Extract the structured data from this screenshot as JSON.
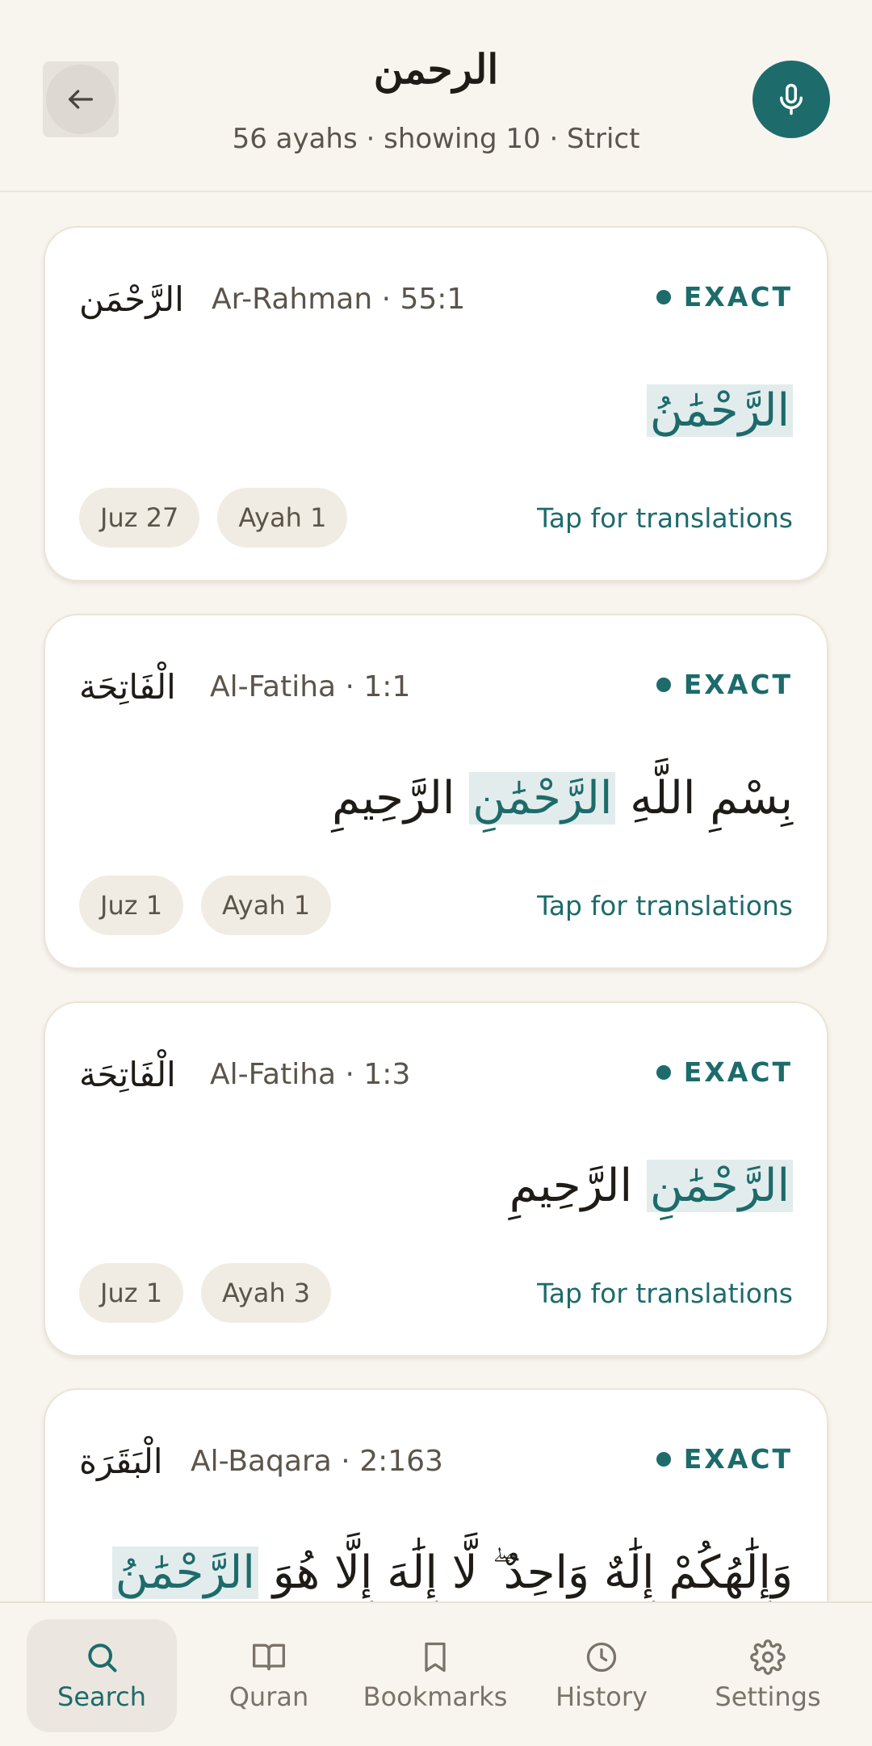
{
  "header": {
    "title": "الرحمن",
    "subtitle": "56 ayahs · showing 10 · Strict",
    "back_icon": "arrow-left-icon",
    "mic_icon": "microphone-icon"
  },
  "results": [
    {
      "surah_ar": "الرَّحْمَن",
      "surah_en": "Ar-Rahman · 55:1",
      "badge": "EXACT",
      "ayah_pre": "",
      "ayah_highlight": "الرَّحْمَٰنُ",
      "ayah_post": "",
      "juz": "Juz 27",
      "ayah_no": "Ayah 1",
      "tap": "Tap for translations"
    },
    {
      "surah_ar": "الْفَاتِحَة",
      "surah_en": "Al-Fatiha · 1:1",
      "badge": "EXACT",
      "ayah_pre": "بِسْمِ اللَّهِ",
      "ayah_highlight": "الرَّحْمَٰنِ",
      "ayah_post": "الرَّحِيمِ",
      "juz": "Juz 1",
      "ayah_no": "Ayah 1",
      "tap": "Tap for translations"
    },
    {
      "surah_ar": "الْفَاتِحَة",
      "surah_en": "Al-Fatiha · 1:3",
      "badge": "EXACT",
      "ayah_pre": "",
      "ayah_highlight": "الرَّحْمَٰنِ",
      "ayah_post": "الرَّحِيمِ",
      "juz": "Juz 1",
      "ayah_no": "Ayah 3",
      "tap": "Tap for translations"
    },
    {
      "surah_ar": "الْبَقَرَة",
      "surah_en": "Al-Baqara · 2:163",
      "badge": "EXACT",
      "ayah_pre": "وَإِلَٰهُكُمْ إِلَٰهٌ وَاحِدٌ ۖ لَّا إِلَٰهَ إِلَّا هُوَ",
      "ayah_highlight": "الرَّحْمَٰنُ",
      "ayah_post": ""
    }
  ],
  "nav": {
    "items": [
      {
        "label": "Search",
        "icon": "search-icon",
        "active": true
      },
      {
        "label": "Quran",
        "icon": "book-icon",
        "active": false
      },
      {
        "label": "Bookmarks",
        "icon": "bookmark-icon",
        "active": false
      },
      {
        "label": "History",
        "icon": "clock-icon",
        "active": false
      },
      {
        "label": "Settings",
        "icon": "gear-icon",
        "active": false
      }
    ]
  },
  "colors": {
    "accent": "#1d6b6b",
    "background": "#f8f5ef",
    "highlight": "#e2ecec"
  }
}
